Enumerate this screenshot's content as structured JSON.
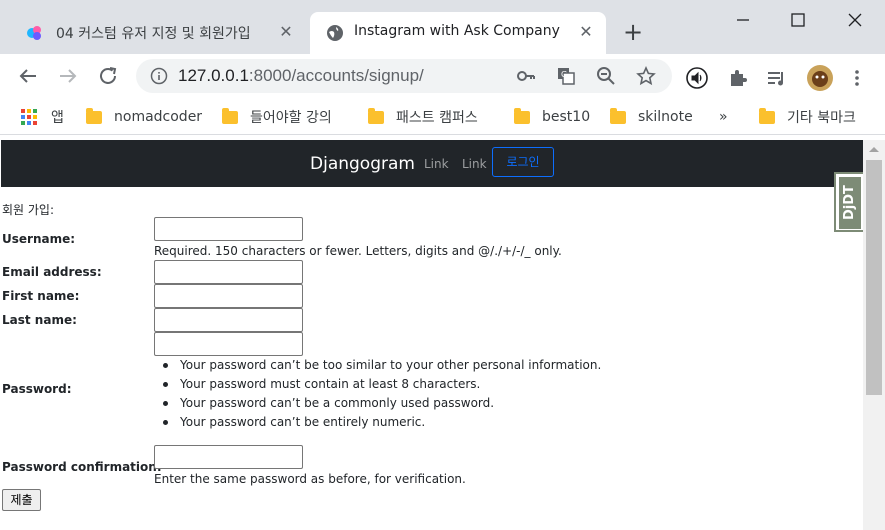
{
  "browser": {
    "tabs": [
      {
        "title": "04 커스텀 유저 지정 및 회원가입",
        "active": false
      },
      {
        "title": "Instagram with Ask Company",
        "active": true
      }
    ],
    "url_host": "127.0.0.1",
    "url_rest": ":8000/accounts/signup/",
    "bookmarks": [
      "앱",
      "nomadcoder",
      "들어야할 강의",
      "패스트 캠퍼스",
      "best10",
      "skilnote",
      "»",
      "기타 북마크"
    ]
  },
  "navbar": {
    "brand": "Djangogram",
    "links": [
      "Link",
      "Link"
    ],
    "login": "로그인"
  },
  "form": {
    "title": "회원 가입:",
    "username_label": "Username:",
    "username_help": "Required. 150 characters or fewer. Letters, digits and @/./+/-/_ only.",
    "email_label": "Email address:",
    "first_name_label": "First name:",
    "last_name_label": "Last name:",
    "password_label": "Password:",
    "password_rules": [
      "Your password can’t be too similar to your other personal information.",
      "Your password must contain at least 8 characters.",
      "Your password can’t be a commonly used password.",
      "Your password can’t be entirely numeric."
    ],
    "password2_label": "Password confirmation:",
    "password2_help": "Enter the same password as before, for verification.",
    "submit": "제출"
  },
  "debug_toolbar": {
    "label": "DjDT",
    "color": "#7d8b76"
  },
  "colors": {
    "navbar_bg": "#212529",
    "login_accent": "#0d6efd",
    "chrome_bg": "#dee1e6"
  }
}
